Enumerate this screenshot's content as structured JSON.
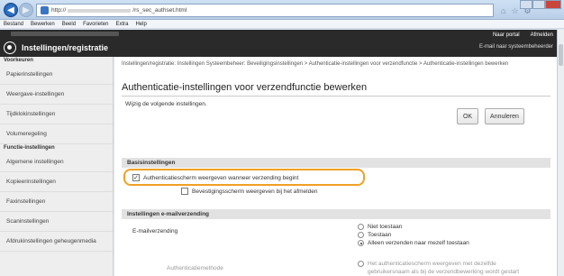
{
  "browser": {
    "address_prefix": "http://",
    "address_path": "/rs_sec_authset.html",
    "menu": [
      "Bestand",
      "Bewerken",
      "Beeld",
      "Favorieten",
      "Extra",
      "Help"
    ]
  },
  "header": {
    "title": "Instellingen/registratie",
    "portal_link": "Naar portal",
    "logout_link": "Afmelden",
    "email_link": "E-mail naar systeembeheerder"
  },
  "sidebar": {
    "sections": [
      {
        "label": "Voorkeuren",
        "items": [
          "Papierinstellingen",
          "Weergave-instellingen",
          "Tijdklokinstellingen",
          "Volumeregeling"
        ]
      },
      {
        "label": "Functie-instellingen",
        "items": [
          "Algemene instellingen",
          "Kopieerinstellingen",
          "Faxinstellingen",
          "Scaninstellingen",
          "Afdrukinstellingen geheugenmedia"
        ]
      }
    ]
  },
  "main": {
    "breadcrumb": "Instellingen/registratie: Instellingen Systeembeheer: Beveiligingsinstellingen > Authenticatie-instellingen voor verzendfunctie > Authenticatie-instellingen bewerken",
    "title": "Authenticatie-instellingen voor verzendfunctie bewerken",
    "intro": "Wijzig de volgende instellingen.",
    "ok_label": "OK",
    "cancel_label": "Annuleren",
    "basis_header": "Basisinstellingen",
    "cb_auth": "Authenticatiescherm weergeven wanneer verzending begint",
    "cb_confirm": "Bevestigingsscherm weergeven bij het afmelden",
    "email_header": "Instellingen e-mailverzending",
    "email_label": "E-mailverzending",
    "radio_1": "Niet toestaan",
    "radio_2": "Toestaan",
    "radio_3": "Alleen verzenden naar mezelf toestaan",
    "auth_label": "Authenticatiemethode",
    "radio_4a": "Het authenticatiescherm weergeven met dezelfde",
    "radio_4b": "gebruikersnaam als bij de verzendbewerking wordt gestart"
  }
}
